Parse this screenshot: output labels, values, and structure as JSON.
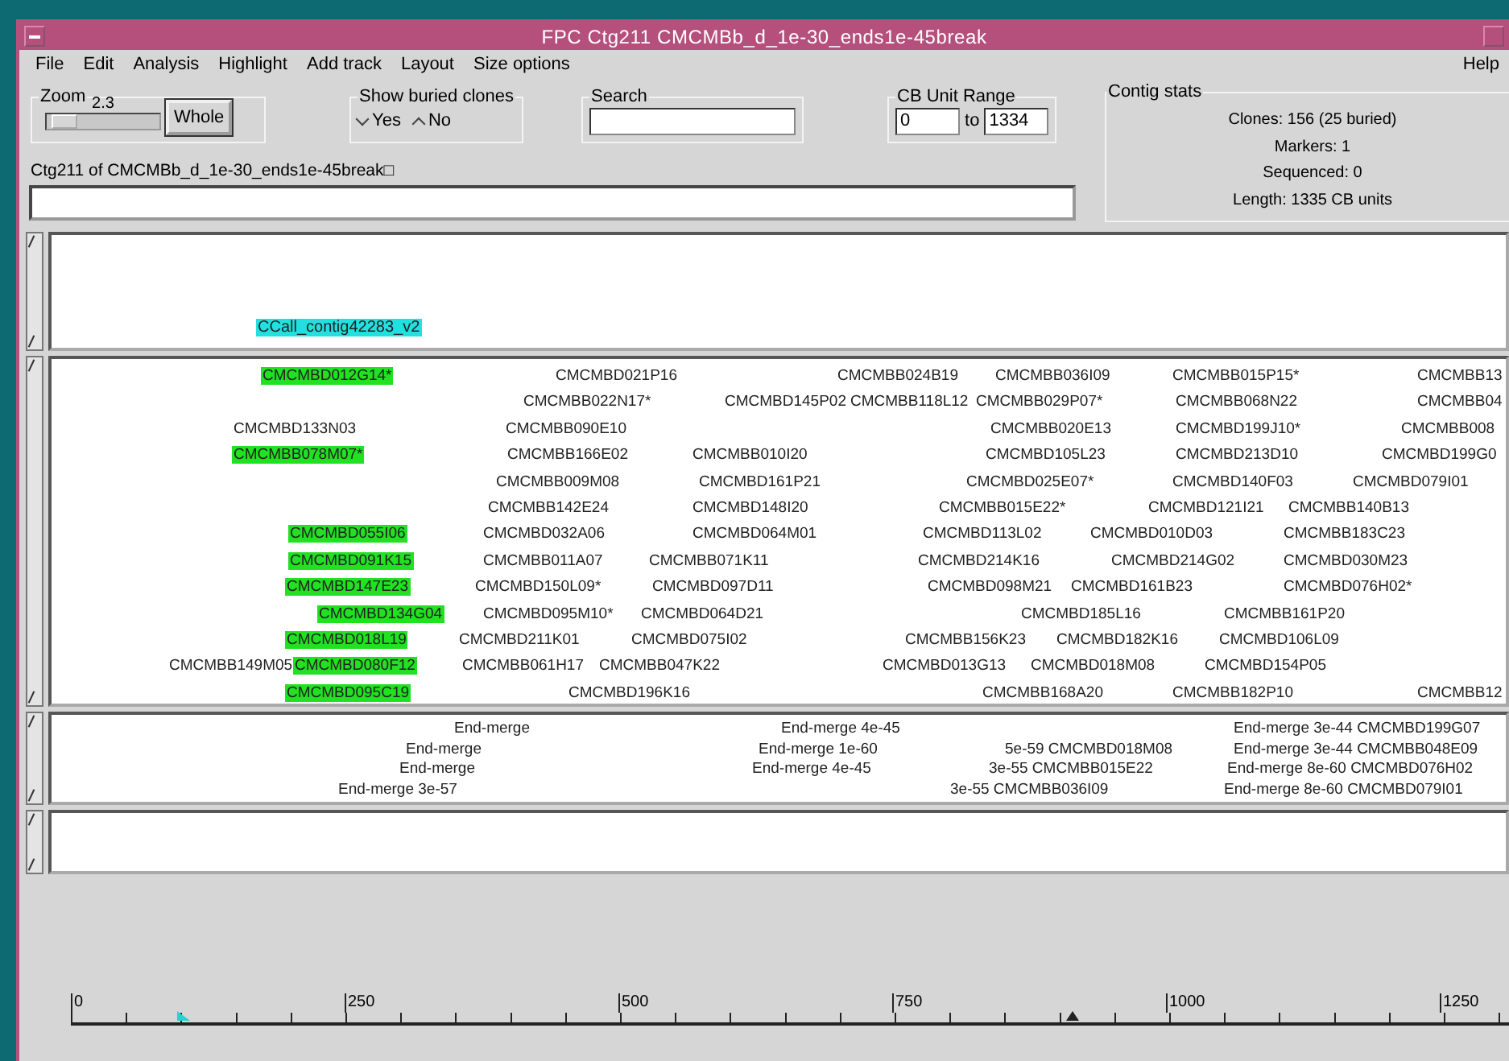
{
  "window": {
    "title": "FPC Ctg211 CMCMBb_d_1e-30_ends1e-45break"
  },
  "menu": [
    "File",
    "Edit",
    "Analysis",
    "Highlight",
    "Add track",
    "Layout",
    "Size options"
  ],
  "help": "Help",
  "zoom": {
    "label": "Zoom",
    "value": "2.3",
    "level": 0.05,
    "button": "Whole"
  },
  "buried": {
    "label": "Show buried clones",
    "options": [
      {
        "label": "Yes",
        "selected": false
      },
      {
        "label": "No",
        "selected": true
      }
    ]
  },
  "search": {
    "label": "Search"
  },
  "cb_range": {
    "label": "CB Unit Range",
    "from": "0",
    "to_label": "to",
    "to": "1334"
  },
  "contig_label": "Ctg211 of CMCMBb_d_1e-30_ends1e-45break□",
  "contig_stats": {
    "label": "Contig stats",
    "lines": [
      "Clones: 156 (25 buried)",
      "Markers: 1",
      "Sequenced: 0",
      "Length: 1335 CB units"
    ]
  },
  "label_track": {
    "labels": [
      {
        "text": "CCall_contig42283_v2"
      }
    ]
  },
  "clone_track": {
    "rows": [
      {
        "clones": [
          {
            "name": "CMCMBD012G14*",
            "highlighted": true
          },
          {
            "name": "CMCMBD021P16",
            "highlighted": false
          },
          {
            "name": "CMCMBB024B19",
            "highlighted": false
          },
          {
            "name": "CMCMBB036I09",
            "highlighted": false
          },
          {
            "name": "CMCMBB015P15*",
            "highlighted": false
          },
          {
            "name": "CMCMBB13",
            "highlighted": false
          }
        ]
      },
      {
        "clones": [
          {
            "name": "CMCMBB022N17*",
            "highlighted": false
          },
          {
            "name": "CMCMBD145P02",
            "highlighted": false
          },
          {
            "name": "CMCMBB118L12",
            "highlighted": false
          },
          {
            "name": "CMCMBB029P07*",
            "highlighted": false
          },
          {
            "name": "CMCMBB068N22",
            "highlighted": false
          },
          {
            "name": "CMCMBB04",
            "highlighted": false
          }
        ]
      },
      {
        "clones": [
          {
            "name": "CMCMBD133N03",
            "highlighted": false
          },
          {
            "name": "CMCMBB090E10",
            "highlighted": false
          },
          {
            "name": "CMCMBB020E13",
            "highlighted": false
          },
          {
            "name": "CMCMBD199J10*",
            "highlighted": false
          },
          {
            "name": "CMCMBB008",
            "highlighted": false
          }
        ]
      },
      {
        "clones": [
          {
            "name": "CMCMBB078M07*",
            "highlighted": true
          },
          {
            "name": "CMCMBB166E02",
            "highlighted": false
          },
          {
            "name": "CMCMBB010I20",
            "highlighted": false
          },
          {
            "name": "CMCMBD105L23",
            "highlighted": false
          },
          {
            "name": "CMCMBD213D10",
            "highlighted": false
          },
          {
            "name": "CMCMBD199G0",
            "highlighted": false
          }
        ]
      },
      {
        "clones": [
          {
            "name": "CMCMBB009M08",
            "highlighted": false
          },
          {
            "name": "CMCMBD161P21",
            "highlighted": false
          },
          {
            "name": "CMCMBD025E07*",
            "highlighted": false
          },
          {
            "name": "CMCMBD140F03",
            "highlighted": false
          },
          {
            "name": "CMCMBD079I01",
            "highlighted": false
          }
        ]
      },
      {
        "clones": [
          {
            "name": "CMCMBB142E24",
            "highlighted": false
          },
          {
            "name": "CMCMBD148I20",
            "highlighted": false
          },
          {
            "name": "CMCMBB015E22*",
            "highlighted": false
          },
          {
            "name": "CMCMBD121I21",
            "highlighted": false
          },
          {
            "name": "CMCMBB140B13",
            "highlighted": false
          }
        ]
      },
      {
        "clones": [
          {
            "name": "CMCMBD055I06",
            "highlighted": true
          },
          {
            "name": "CMCMBD032A06",
            "highlighted": false
          },
          {
            "name": "CMCMBD064M01",
            "highlighted": false
          },
          {
            "name": "CMCMBD113L02",
            "highlighted": false
          },
          {
            "name": "CMCMBD010D03",
            "highlighted": false
          },
          {
            "name": "CMCMBB183C23",
            "highlighted": false
          }
        ]
      },
      {
        "clones": [
          {
            "name": "CMCMBD091K15",
            "highlighted": true
          },
          {
            "name": "CMCMBB011A07",
            "highlighted": false
          },
          {
            "name": "CMCMBB071K11",
            "highlighted": false
          },
          {
            "name": "CMCMBD214K16",
            "highlighted": false
          },
          {
            "name": "CMCMBD214G02",
            "highlighted": false
          },
          {
            "name": "CMCMBD030M23",
            "highlighted": false
          }
        ]
      },
      {
        "clones": [
          {
            "name": "CMCMBD147E23",
            "highlighted": true
          },
          {
            "name": "CMCMBD150L09*",
            "highlighted": false
          },
          {
            "name": "CMCMBD097D11",
            "highlighted": false
          },
          {
            "name": "CMCMBD098M21",
            "highlighted": false
          },
          {
            "name": "CMCMBD161B23",
            "highlighted": false
          },
          {
            "name": "CMCMBD076H02*",
            "highlighted": false
          }
        ]
      },
      {
        "clones": [
          {
            "name": "CMCMBD134G04",
            "highlighted": true
          },
          {
            "name": "CMCMBD095M10*",
            "highlighted": false
          },
          {
            "name": "CMCMBD064D21",
            "highlighted": false
          },
          {
            "name": "CMCMBD185L16",
            "highlighted": false
          },
          {
            "name": "CMCMBB161P20",
            "highlighted": false
          }
        ]
      },
      {
        "clones": [
          {
            "name": "CMCMBD018L19",
            "highlighted": true
          },
          {
            "name": "CMCMBD211K01",
            "highlighted": false
          },
          {
            "name": "CMCMBD075I02",
            "highlighted": false
          },
          {
            "name": "CMCMBB156K23",
            "highlighted": false
          },
          {
            "name": "CMCMBD182K16",
            "highlighted": false
          },
          {
            "name": "CMCMBD106L09",
            "highlighted": false
          }
        ]
      },
      {
        "clones": [
          {
            "name": "CMCMBB149M05",
            "highlighted": false
          },
          {
            "name": "CMCMBD080F12",
            "highlighted": true
          },
          {
            "name": "CMCMBB061H17",
            "highlighted": false
          },
          {
            "name": "CMCMBB047K22",
            "highlighted": false
          },
          {
            "name": "CMCMBD013G13",
            "highlighted": false
          },
          {
            "name": "CMCMBD018M08",
            "highlighted": false
          },
          {
            "name": "CMCMBD154P05",
            "highlighted": false
          }
        ]
      },
      {
        "clones": [
          {
            "name": "CMCMBD095C19",
            "highlighted": true
          },
          {
            "name": "CMCMBD196K16",
            "highlighted": false
          },
          {
            "name": "CMCMBB168A20",
            "highlighted": false
          },
          {
            "name": "CMCMBB182P10",
            "highlighted": false
          },
          {
            "name": "CMCMBB12",
            "highlighted": false
          }
        ]
      }
    ]
  },
  "merge_track": {
    "rows": [
      {
        "items": [
          "End-merge",
          "End-merge 4e-45",
          "End-merge 3e-44 CMCMBD199G07"
        ]
      },
      {
        "items": [
          "End-merge",
          "End-merge 1e-60",
          "5e-59 CMCMBD018M08",
          "End-merge 3e-44 CMCMBB048E09"
        ]
      },
      {
        "items": [
          "End-merge",
          "End-merge 4e-45",
          "3e-55 CMCMBB015E22",
          "End-merge 8e-60 CMCMBD076H02"
        ]
      },
      {
        "items": [
          "End-merge 3e-57",
          "3e-55 CMCMBB036I09",
          "End-merge 8e-60 CMCMBD079I01"
        ]
      }
    ]
  },
  "ruler": {
    "labels": [
      "0",
      "250",
      "500",
      "750",
      "1000",
      "1250"
    ]
  }
}
